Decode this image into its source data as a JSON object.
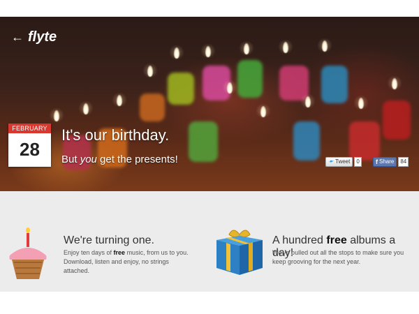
{
  "hero": {
    "logo_text": "flyte",
    "calendar_month": "FEBRUARY",
    "calendar_day": "28",
    "headline": "It's our birthday.",
    "sub_pre": "But ",
    "sub_em": "you",
    "sub_post": " get the presents!",
    "tweet_label": "Tweet",
    "tweet_count": "0",
    "share_label": "Share",
    "share_count": "84"
  },
  "features": [
    {
      "title": "We're turning one.",
      "body_pre": "Enjoy ten days of ",
      "body_bold": "free",
      "body_post": " music, from us to you. Download, listen and enjoy, no strings attached."
    },
    {
      "title_pre": "A hundred ",
      "title_bold": "free",
      "title_post": " albums a day!",
      "body": "We've pulled out all the stops to make sure you keep grooving for the next year."
    }
  ],
  "icons": [
    "back-arrow-icon",
    "birthday-cake-icon",
    "gift-box-icon",
    "twitter-icon",
    "facebook-icon"
  ],
  "colors": {
    "calendar_red": "#d8382e",
    "facebook_blue": "#5f78ab",
    "band_bg": "#ececec"
  }
}
